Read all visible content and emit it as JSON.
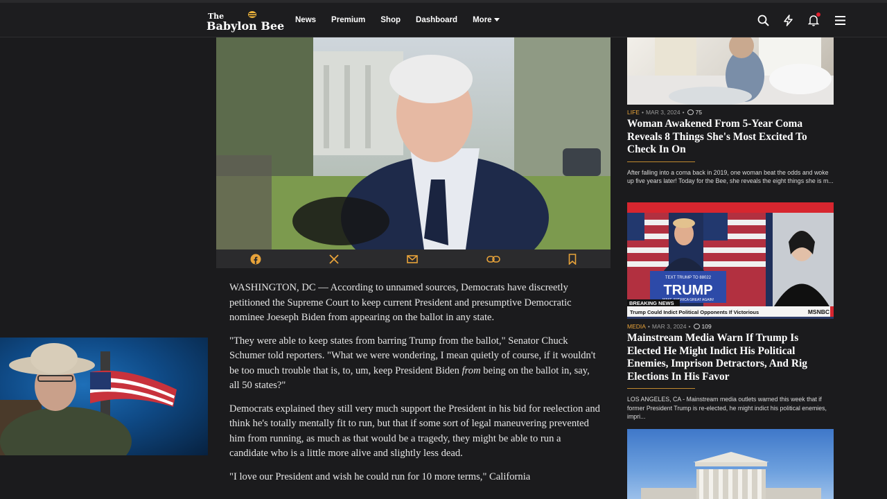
{
  "brand": {
    "line1": "The",
    "line2": "Babylon Bee"
  },
  "nav": {
    "items": [
      {
        "label": "News"
      },
      {
        "label": "Premium"
      },
      {
        "label": "Shop"
      },
      {
        "label": "Dashboard"
      },
      {
        "label": "More"
      }
    ],
    "icons": [
      "search-icon",
      "lightning-icon",
      "bell-icon",
      "menu-icon"
    ],
    "accent_color": "#e8a33a",
    "notification_dot_color": "#e0202f"
  },
  "share": {
    "icons": [
      "facebook-icon",
      "x-icon",
      "email-icon",
      "link-icon",
      "bookmark-icon"
    ],
    "icon_color": "#e8a33a"
  },
  "article": {
    "paragraphs": [
      {
        "parts": [
          "WASHINGTON, DC — According to unnamed sources, Democrats have discreetly petitioned the Supreme Court to keep current President and presumptive Democratic nominee Joeseph Biden from appearing on the ballot in any state."
        ]
      },
      {
        "before": "\"They were able to keep states from barring Trump from the ballot,\" Senator Chuck Schumer told reporters. \"What we were wondering, I mean quietly of course, if it wouldn't be too much trouble that is, to, um, keep President Biden ",
        "em": "from",
        "after": " being on the ballot in, say, all 50 states?\""
      },
      {
        "parts": [
          "Democrats explained they still very much support the President in his bid for reelection and think he's totally mentally fit to run, but that if some sort of legal maneuvering prevented him from running, as much as that would be a tragedy, they might be able to run a candidate who is a little more alive and slightly less dead."
        ]
      },
      {
        "parts": [
          "\"I love our President and wish he could run for 10 more terms,\" California"
        ]
      }
    ]
  },
  "sidebar": {
    "cards": [
      {
        "category": "LIFE",
        "date": "MAR 3, 2024",
        "comments": "75",
        "title": "Woman Awakened From 5-Year Coma Reveals 8 Things She's Most Excited To Check In On",
        "excerpt": "After falling into a coma back in 2019, one woman beat the odds and woke up five years later! Today for the Bee, she reveals the eight things she is m..."
      },
      {
        "category": "MEDIA",
        "date": "MAR 3, 2024",
        "comments": "109",
        "title": "Mainstream Media Warn If Trump Is Elected He Might Indict His Political Enemies, Imprison Detractors, And Rig Elections In His Favor",
        "excerpt": "LOS ANGELES, CA - Mainstream media outlets warned this week that if former President Trump is re-elected, he might indict his political enemies, impri...",
        "image_text": {
          "sign_small": "TEXT TRUMP TO 88022",
          "sign_big": "TRUMP",
          "sign_tag": "MAKE AMERICA GREAT AGAIN!",
          "breaking": "BREAKING NEWS",
          "ticker": "Trump Could Indict Political Opponents If Victorious",
          "network": "MSNBC"
        }
      }
    ]
  }
}
